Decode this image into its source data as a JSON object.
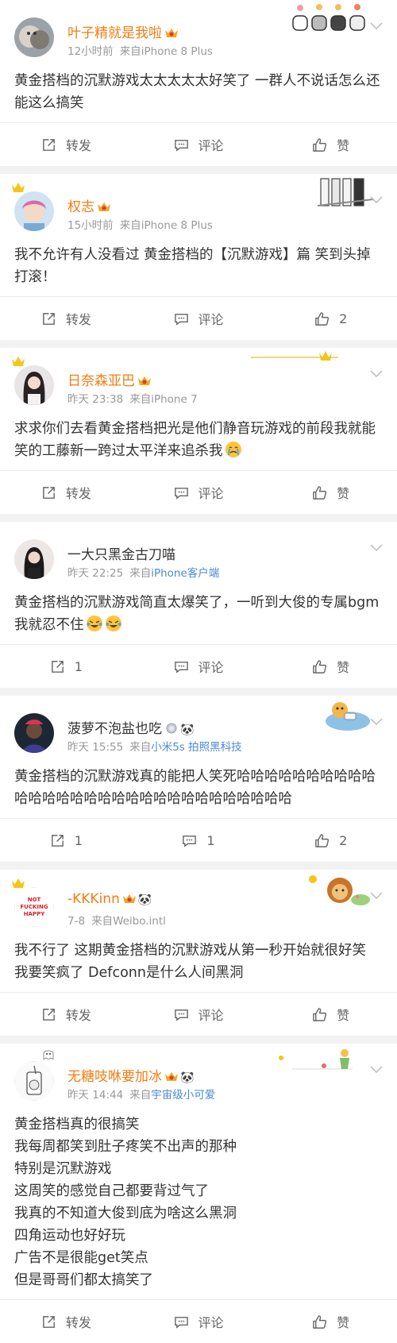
{
  "posts": [
    {
      "name": "叶子精就是我啦",
      "time": "12小时前",
      "source_prefix": "来自",
      "device": "iPhone 8 Plus",
      "text": "黄金搭档的沉默游戏太太太太太好笑了 一群人不说话怎么还能这么搞笑",
      "repost": "转发",
      "comment": "评论",
      "like": "赞"
    },
    {
      "name": "权志",
      "time": "15小时前",
      "source_prefix": "来自",
      "device": "iPhone 8 Plus",
      "text": "我不允许有人没看过 黄金搭档的【沉默游戏】篇 笑到头掉 打滚！",
      "repost": "转发",
      "comment": "评论",
      "like": "2"
    },
    {
      "name": "日奈森亚巴",
      "time": "昨天 23:38",
      "source_prefix": "来自",
      "device": "iPhone 7",
      "text": "求求你们去看黄金搭档把光是他们静音玩游戏的前段我就能笑的工藤新一跨过太平洋来追杀我",
      "repost": "转发",
      "comment": "评论",
      "like": "赞"
    },
    {
      "name": "一大只黑金古刀喵",
      "time": "昨天 22:25",
      "source_prefix": "来自",
      "device": "iPhone客户端",
      "text": "黄金搭档的沉默游戏简直太爆笑了，一听到大俊的专属bgm我就忍不住",
      "repost": "1",
      "comment": "评论",
      "like": "赞"
    },
    {
      "name": "菠萝不泡盐也吃",
      "time": "昨天 15:55",
      "source_prefix": "来自",
      "device": "小米5s 拍照黑科技",
      "text": "黄金搭档的沉默游戏真的能把人笑死哈哈哈哈哈哈哈哈哈哈哈哈哈哈哈哈哈哈哈哈哈哈哈哈哈哈哈哈哈哈",
      "repost": "1",
      "comment": "1",
      "like": "2"
    },
    {
      "name": "-KKKinn",
      "time": "7-8",
      "source_prefix": "来自",
      "device": "Weibo.intl",
      "avatar_text": "NOT FUCKING HAPPY",
      "text": "我不行了 这期黄金搭档的沉默游戏从第一秒开始就很好笑 我要笑疯了 Defconn是什么人间黑洞",
      "repost": "转发",
      "comment": "评论",
      "like": "赞"
    },
    {
      "name": "无糖吱咻要加冰",
      "time": "昨天 14:44",
      "source_prefix": "来自",
      "device": "宇宙级小可爱",
      "text": "黄金搭档真的很搞笑\n我每周都笑到肚子疼笑不出声的那种\n特别是沉默游戏\n这周笑的感觉自己都要背过气了\n我真的不知道大俊到底为啥这么黑洞\n四角运动也好好玩\n广告不是很能get笑点\n但是哥哥们都太搞笑了",
      "repost": "转发",
      "comment": "评论",
      "like": "赞"
    }
  ],
  "colors": {
    "vip_name": "#f37d12",
    "link": "#4b8ad0",
    "meta": "#999999",
    "text": "#333333",
    "background": "#f2f2f2"
  }
}
